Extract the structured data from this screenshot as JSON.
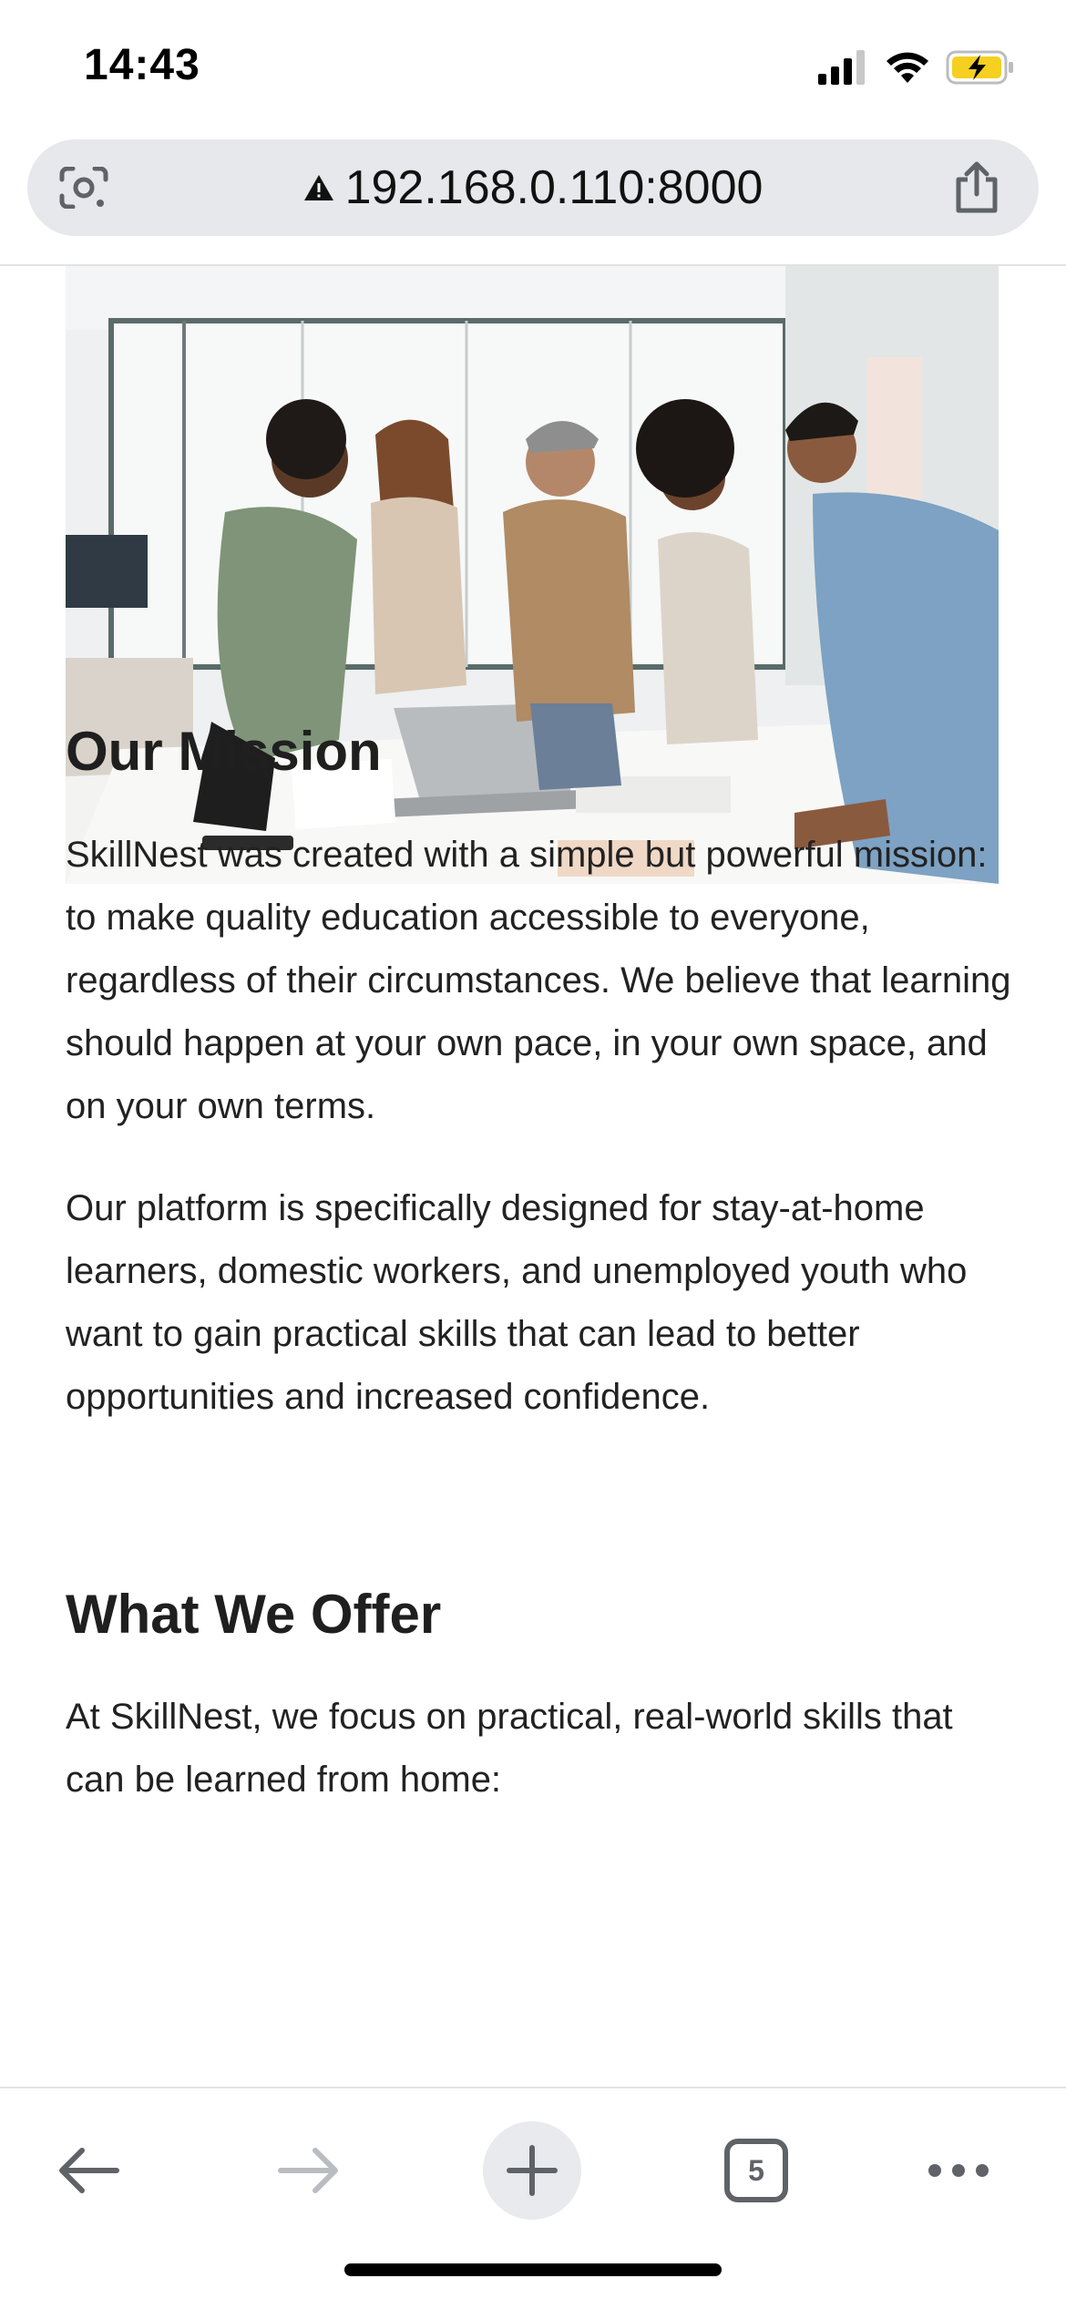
{
  "status": {
    "time": "14:43"
  },
  "browser": {
    "url": "192.168.0.110:8000",
    "tab_count": "5"
  },
  "content": {
    "mission_heading": "Our Mission",
    "mission_p1": "SkillNest was created with a simple but powerful mission: to make quality education accessible to everyone, regardless of their circumstances. We believe that learning should happen at your own pace, in your own space, and on your own terms.",
    "mission_p2": "Our platform is specifically designed for stay-at-home learners, domestic workers, and unemployed youth who want to gain practical skills that can lead to better opportunities and increased confidence.",
    "offer_heading": "What We Offer",
    "offer_p1": "At SkillNest, we focus on practical, real-world skills that can be learned from home:"
  },
  "icons": {
    "signal": "cellular-signal-icon",
    "wifi": "wifi-icon",
    "battery": "battery-charging-icon",
    "lens": "camera-lens-icon",
    "warning": "not-secure-warning-icon",
    "share": "share-icon",
    "back": "back-arrow-icon",
    "forward": "forward-arrow-icon",
    "new_tab": "plus-icon",
    "tabs": "tabs-icon",
    "more": "more-icon"
  },
  "colors": {
    "battery": "#f5d020",
    "url_bar_bg": "#e6e8eb",
    "disabled_icon": "#b9bcc0",
    "icon": "#5f6368"
  }
}
